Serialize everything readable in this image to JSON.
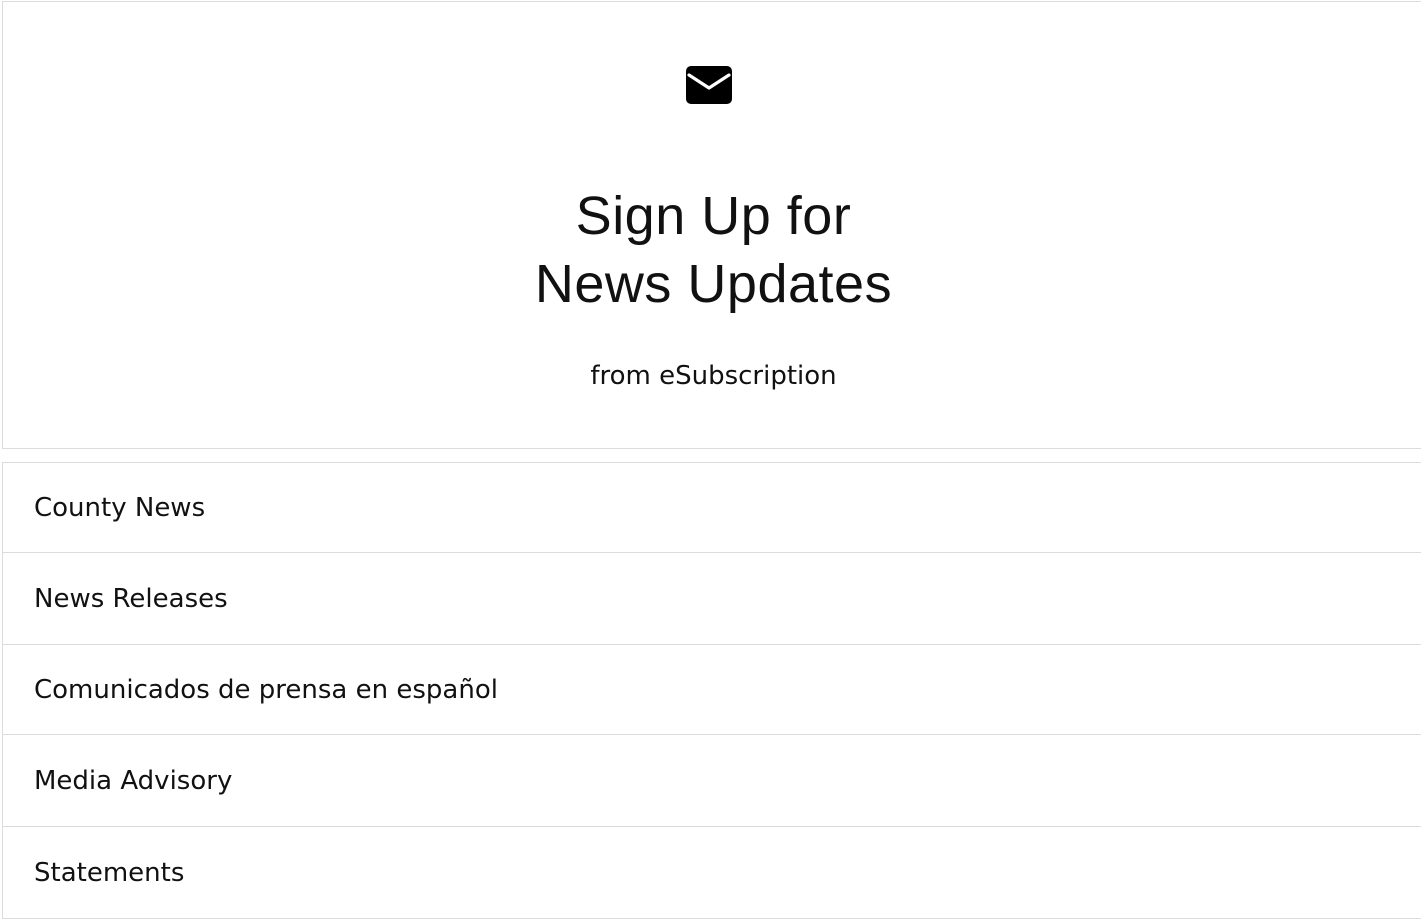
{
  "signup": {
    "icon": "envelope-icon",
    "title_line1": "Sign Up for",
    "title_line2": "News Updates",
    "subtitle": "from eSubscription"
  },
  "topics": [
    {
      "label": "County News"
    },
    {
      "label": "News Releases"
    },
    {
      "label": "Comunicados de prensa en español"
    },
    {
      "label": "Media Advisory"
    },
    {
      "label": "Statements"
    }
  ]
}
